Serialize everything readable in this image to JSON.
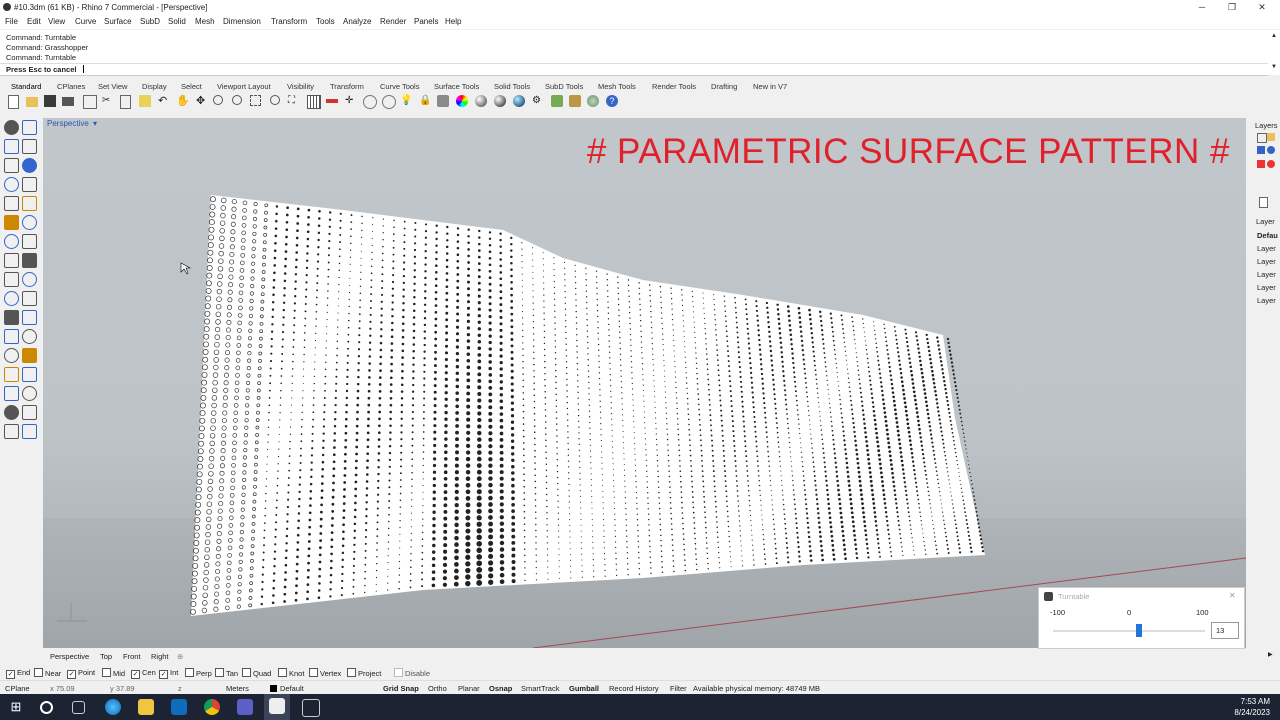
{
  "window": {
    "title": "#10.3dm (61 KB) - Rhino 7 Commercial - [Perspective]",
    "controls": {
      "minimize": "─",
      "restore": "❐",
      "close": "✕"
    }
  },
  "menu": [
    "File",
    "Edit",
    "View",
    "Curve",
    "Surface",
    "SubD",
    "Solid",
    "Mesh",
    "Dimension",
    "Transform",
    "Tools",
    "Analyze",
    "Render",
    "Panels",
    "Help"
  ],
  "command_history": [
    "Command: Turntable",
    "Command: Grasshopper",
    "Command: Turntable"
  ],
  "command_prompt": "Press Esc to cancel",
  "toolbar_tabs": [
    "Standard",
    "CPlanes",
    "Set View",
    "Display",
    "Select",
    "Viewport Layout",
    "Visibility",
    "Transform",
    "Curve Tools",
    "Surface Tools",
    "Solid Tools",
    "SubD Tools",
    "Mesh Tools",
    "Render Tools",
    "Drafting",
    "New in V7"
  ],
  "viewport": {
    "name": "Perspective",
    "dropdown_glyph": "▾",
    "overlay_title": "# PARAMETRIC SURFACE PATTERN #"
  },
  "right_panel": {
    "header": "Layers",
    "column": "Layer",
    "items": [
      "Defau",
      "Layer",
      "Layer",
      "Layer",
      "Layer",
      "Layer"
    ]
  },
  "viewport_tabs": [
    "Perspective",
    "Top",
    "Front",
    "Right"
  ],
  "add_tab_glyph": "⊕",
  "osnaps": [
    {
      "label": "End",
      "checked": true
    },
    {
      "label": "Near",
      "checked": false
    },
    {
      "label": "Point",
      "checked": true
    },
    {
      "label": "Mid",
      "checked": false
    },
    {
      "label": "Cen",
      "checked": true
    },
    {
      "label": "Int",
      "checked": true
    },
    {
      "label": "Perp",
      "checked": false
    },
    {
      "label": "Tan",
      "checked": false
    },
    {
      "label": "Quad",
      "checked": false
    },
    {
      "label": "Knot",
      "checked": false
    },
    {
      "label": "Vertex",
      "checked": false
    },
    {
      "label": "Project",
      "checked": false
    },
    {
      "label": "Disable",
      "checked": false
    }
  ],
  "status": {
    "cplane": "CPlane",
    "x": "x 75.09",
    "y": "y 37.89",
    "z": "z",
    "units": "Meters",
    "layer": "Default",
    "grid_snap": "Grid Snap",
    "ortho": "Ortho",
    "planar": "Planar",
    "osnap": "Osnap",
    "smarttrack": "SmartTrack",
    "gumball": "Gumball",
    "record_history": "Record History",
    "filter": "Filter",
    "memory": "Available physical memory: 48749 MB"
  },
  "turntable": {
    "title": "Turntable",
    "min_label": "-100",
    "mid_label": "0",
    "max_label": "100",
    "value": "13",
    "slider_fraction": 0.565
  },
  "clock": {
    "time": "7:53 AM",
    "date": "8/24/2023"
  },
  "colors": {
    "overlay_title": "#e0202a",
    "viewport_label": "#2a55b8",
    "taskbar": "#1c2433"
  }
}
